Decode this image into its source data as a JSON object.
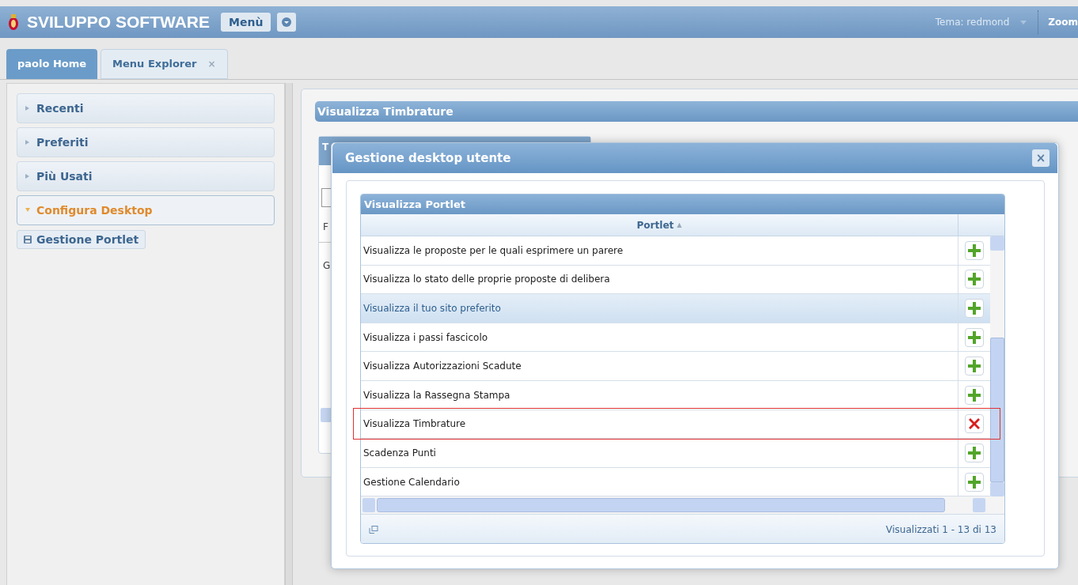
{
  "header": {
    "title": "SVILUPPO SOFTWARE",
    "menu_button": "Menù",
    "theme": "Tema: redmond",
    "zoom": "Zoom"
  },
  "tabs": [
    {
      "label": "paolo Home",
      "selected": true
    },
    {
      "label": "Menu Explorer",
      "selected": false,
      "close": "×"
    }
  ],
  "sidebar": {
    "sections": [
      {
        "label": "Recenti",
        "expanded": false
      },
      {
        "label": "Preferiti",
        "expanded": false
      },
      {
        "label": "Più Usati",
        "expanded": false
      },
      {
        "label": "Configura Desktop",
        "expanded": true,
        "items": [
          "Gestione Portlet"
        ]
      }
    ]
  },
  "background_portlet": {
    "title": "Visualizza Timbrature",
    "inner_title": "T",
    "inner_rows": [
      "F",
      "G"
    ]
  },
  "dialog": {
    "title": "Gestione desktop utente",
    "close": "×",
    "grid": {
      "title": "Visualizza Portlet",
      "column": "Portlet",
      "sort": "▲",
      "rows": [
        {
          "name": "Visualizza le proposte per le quali esprimere un parere",
          "kind": "add",
          "selected": false,
          "outlined": false
        },
        {
          "name": "Visualizza lo stato delle proprie proposte di delibera",
          "kind": "add",
          "selected": false,
          "outlined": false
        },
        {
          "name": "Visualizza il tuo sito preferito",
          "kind": "add",
          "selected": true,
          "outlined": false
        },
        {
          "name": "Visualizza i passi fascicolo",
          "kind": "add",
          "selected": false,
          "outlined": false
        },
        {
          "name": "Visualizza Autorizzazioni Scadute",
          "kind": "add",
          "selected": false,
          "outlined": false
        },
        {
          "name": "Visualizza la Rassegna Stampa",
          "kind": "add",
          "selected": false,
          "outlined": false
        },
        {
          "name": "Visualizza Timbrature",
          "kind": "remove",
          "selected": false,
          "outlined": true
        },
        {
          "name": "Scadenza Punti",
          "kind": "add",
          "selected": false,
          "outlined": false
        },
        {
          "name": "Gestione Calendario",
          "kind": "add",
          "selected": false,
          "outlined": false
        }
      ],
      "footer": "Visualizzati 1 - 13 di 13"
    }
  }
}
